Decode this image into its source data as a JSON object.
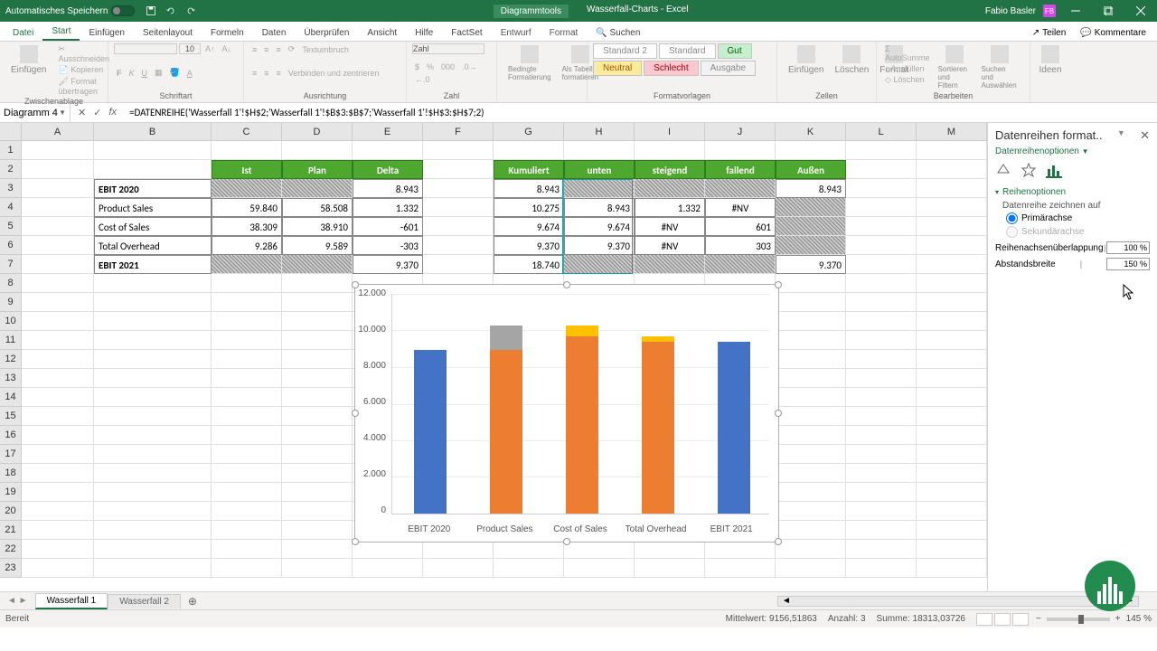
{
  "title_bar": {
    "autosave": "Automatisches Speichern",
    "tool_context": "Diagrammtools",
    "doc_title": "Wasserfall-Charts - Excel",
    "user_name": "Fabio Basler",
    "user_initials": "FB"
  },
  "ribbon_tabs": [
    "Datei",
    "Start",
    "Einfügen",
    "Seitenlayout",
    "Formeln",
    "Daten",
    "Überprüfen",
    "Ansicht",
    "Hilfe",
    "FactSet",
    "Entwurf",
    "Format"
  ],
  "ribbon_search": "Suchen",
  "ribbon_right": {
    "teilen": "Teilen",
    "kommentare": "Kommentare"
  },
  "ribbon_groups": {
    "clipboard": {
      "label": "Zwischenablage",
      "cut": "Ausschneiden",
      "copy": "Kopieren",
      "paint": "Format übertragen",
      "paste": "Einfügen"
    },
    "font": {
      "label": "Schriftart",
      "size": "10"
    },
    "align": {
      "label": "Ausrichtung",
      "wrap": "Textumbruch",
      "merge": "Verbinden und zentrieren"
    },
    "number": {
      "label": "Zahl",
      "format": "Zahl"
    },
    "cond": {
      "cond": "Bedingte Formatierung",
      "table": "Als Tabelle formatieren"
    },
    "styles": {
      "label": "Formatvorlagen",
      "r1": [
        "Standard 2",
        "Standard",
        "Gut"
      ],
      "r2": [
        "Neutral",
        "Schlecht",
        "Ausgabe"
      ]
    },
    "cells": {
      "label": "Zellen",
      "insert": "Einfügen",
      "delete": "Löschen",
      "format": "Format"
    },
    "edit": {
      "label": "Bearbeiten",
      "sum": "AutoSumme",
      "fill": "Ausfüllen",
      "clear": "Löschen",
      "sort": "Sortieren und Filtern",
      "find": "Suchen und Auswählen"
    },
    "ideas": "Ideen"
  },
  "name_box": "Diagramm 4",
  "formula": "=DATENREIHE('Wasserfall 1'!$H$2;'Wasserfall 1'!$B$3:$B$7;'Wasserfall 1'!$H$3:$H$7;2)",
  "columns": [
    "A",
    "B",
    "C",
    "D",
    "E",
    "F",
    "G",
    "H",
    "I",
    "J",
    "K",
    "L",
    "M"
  ],
  "table1": {
    "headers": [
      "Ist",
      "Plan",
      "Delta"
    ],
    "row_labels": [
      "EBIT 2020",
      "Product Sales",
      "Cost of Sales",
      "Total Overhead",
      "EBIT 2021"
    ],
    "data": {
      "r3": {
        "E": "8.943"
      },
      "r4": {
        "C": "59.840",
        "D": "58.508",
        "E": "1.332"
      },
      "r5": {
        "C": "38.309",
        "D": "38.910",
        "E": "-601"
      },
      "r6": {
        "C": "9.286",
        "D": "9.589",
        "E": "-303"
      },
      "r7": {
        "E": "9.370"
      }
    }
  },
  "table2": {
    "headers": [
      "Kumuliert",
      "unten",
      "steigend",
      "fallend",
      "Außen"
    ],
    "data": {
      "r3": {
        "G": "8.943",
        "K": "8.943"
      },
      "r4": {
        "G": "10.275",
        "H": "8.943",
        "I": "1.332",
        "J": "#NV"
      },
      "r5": {
        "G": "9.674",
        "H": "9.674",
        "I": "#NV",
        "J": "601"
      },
      "r6": {
        "G": "9.370",
        "H": "9.370",
        "I": "#NV",
        "J": "303"
      },
      "r7": {
        "G": "18.740",
        "K": "9.370"
      }
    }
  },
  "chart_data": {
    "type": "bar",
    "categories": [
      "EBIT 2020",
      "Product Sales",
      "Cost of Sales",
      "Total Overhead",
      "EBIT 2021"
    ],
    "series": [
      {
        "name": "Außen",
        "color": "#4472c4",
        "values": [
          8943,
          null,
          null,
          null,
          9370
        ]
      },
      {
        "name": "unten",
        "color": "#ed7d31",
        "values": [
          null,
          8943,
          9674,
          9370,
          null
        ]
      },
      {
        "name": "steigend",
        "color": "#a5a5a5",
        "values": [
          null,
          1332,
          null,
          null,
          null
        ]
      },
      {
        "name": "fallend",
        "color": "#ffc000",
        "values": [
          null,
          null,
          601,
          303,
          null
        ]
      }
    ],
    "ylim": [
      0,
      12000
    ],
    "y_ticks": [
      "12.000",
      "10.000",
      "8.000",
      "6.000",
      "4.000",
      "2.000",
      "0"
    ]
  },
  "task_pane": {
    "title": "Datenreihen format..",
    "subtitle": "Datenreihenoptionen",
    "section": "Reihenoptionen",
    "draw_on": "Datenreihe zeichnen auf",
    "primary": "Primärachse",
    "secondary": "Sekundärachse",
    "overlap_label": "Reihenachsenüberlappung",
    "overlap_value": "100 %",
    "gap_label": "Abstandsbreite",
    "gap_value": "150 %"
  },
  "sheet_tabs": [
    "Wasserfall 1",
    "Wasserfall 2"
  ],
  "status": {
    "ready": "Bereit",
    "avg_label": "Mittelwert:",
    "avg": "9156,51863",
    "count_label": "Anzahl:",
    "count": "3",
    "sum_label": "Summe:",
    "sum": "18313,03726",
    "zoom": "145 %"
  }
}
